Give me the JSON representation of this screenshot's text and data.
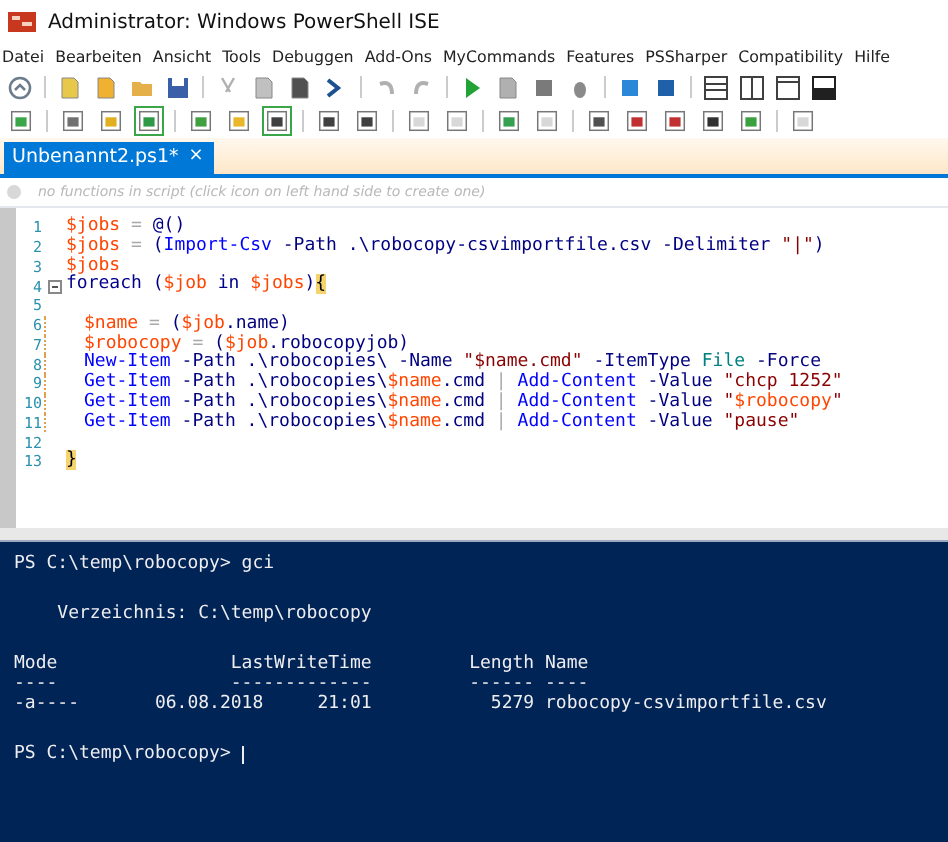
{
  "window": {
    "title": "Administrator: Windows PowerShell ISE"
  },
  "menu": [
    "Datei",
    "Bearbeiten",
    "Ansicht",
    "Tools",
    "Debuggen",
    "Add-Ons",
    "MyCommands",
    "Features",
    "PSSharper",
    "Compatibility",
    "Hilfe"
  ],
  "toolbar_2": {
    "groups": [
      [
        {
          "pressed": false,
          "disabled": false
        }
      ],
      [
        {
          "pressed": false,
          "disabled": false
        },
        {
          "pressed": false,
          "disabled": false
        },
        {
          "pressed": true,
          "disabled": false
        }
      ],
      [
        {
          "pressed": false,
          "disabled": false
        },
        {
          "pressed": false,
          "disabled": false
        },
        {
          "pressed": true,
          "disabled": false
        }
      ],
      [
        {
          "pressed": false,
          "disabled": false
        },
        {
          "pressed": false,
          "disabled": false
        }
      ],
      [
        {
          "pressed": false,
          "disabled": true
        },
        {
          "pressed": false,
          "disabled": true
        }
      ],
      [
        {
          "pressed": false,
          "disabled": false
        },
        {
          "pressed": false,
          "disabled": true
        }
      ],
      [
        {
          "pressed": false,
          "disabled": false
        },
        {
          "pressed": false,
          "disabled": false
        },
        {
          "pressed": false,
          "disabled": false
        },
        {
          "pressed": false,
          "disabled": false
        },
        {
          "pressed": false,
          "disabled": false
        }
      ],
      [
        {
          "pressed": false,
          "disabled": true
        }
      ]
    ]
  },
  "tabs": [
    {
      "label": "Unbenannt2.ps1*",
      "close": "×",
      "selected": true
    }
  ],
  "hint": "no functions in script (click icon on left hand side to create one)",
  "editor": {
    "lines": [
      {
        "n": "1",
        "fold": false,
        "indent": false,
        "tokens": [
          {
            "kind": "var",
            "text": "$jobs"
          },
          {
            "kind": "op",
            "text": " = "
          },
          {
            "kind": "plain",
            "text": "@()"
          }
        ]
      },
      {
        "n": "2",
        "fold": false,
        "indent": false,
        "tokens": [
          {
            "kind": "var",
            "text": "$jobs"
          },
          {
            "kind": "op",
            "text": " = "
          },
          {
            "kind": "plain",
            "text": "("
          },
          {
            "kind": "cmd",
            "text": "Import-Csv"
          },
          {
            "kind": "param",
            "text": " -Path"
          },
          {
            "kind": "plain",
            "text": " .\\robocopy-csvimportfile.csv"
          },
          {
            "kind": "param",
            "text": " -Delimiter"
          },
          {
            "kind": "str",
            "text": " \"|\""
          },
          {
            "kind": "plain",
            "text": ")"
          }
        ]
      },
      {
        "n": "3",
        "fold": false,
        "indent": false,
        "tokens": [
          {
            "kind": "var",
            "text": "$jobs"
          }
        ]
      },
      {
        "n": "4",
        "fold": true,
        "indent": false,
        "tokens": [
          {
            "kind": "kw",
            "text": "foreach"
          },
          {
            "kind": "plain",
            "text": " ("
          },
          {
            "kind": "var",
            "text": "$job"
          },
          {
            "kind": "kw",
            "text": " in "
          },
          {
            "kind": "var",
            "text": "$jobs"
          },
          {
            "kind": "plain",
            "text": ")"
          },
          {
            "kind": "brace",
            "text": "{"
          }
        ]
      },
      {
        "n": "5",
        "fold": false,
        "indent": true
      },
      {
        "n": "6",
        "fold": false,
        "indent": true,
        "tokens": [
          {
            "kind": "var",
            "text": "$name"
          },
          {
            "kind": "op",
            "text": " = "
          },
          {
            "kind": "plain",
            "text": "("
          },
          {
            "kind": "var",
            "text": "$job"
          },
          {
            "kind": "plain",
            "text": ".name)"
          }
        ]
      },
      {
        "n": "7",
        "fold": false,
        "indent": true,
        "tokens": [
          {
            "kind": "var",
            "text": "$robocopy"
          },
          {
            "kind": "op",
            "text": " = "
          },
          {
            "kind": "plain",
            "text": "("
          },
          {
            "kind": "var",
            "text": "$job"
          },
          {
            "kind": "plain",
            "text": ".robocopyjob)"
          }
        ]
      },
      {
        "n": "8",
        "fold": false,
        "indent": true,
        "tokens": [
          {
            "kind": "cmd",
            "text": "New-Item"
          },
          {
            "kind": "param",
            "text": " -Path"
          },
          {
            "kind": "plain",
            "text": " .\\robocopies\\ "
          },
          {
            "kind": "param",
            "text": "-Name"
          },
          {
            "kind": "str",
            "text": " \"$name.cmd\""
          },
          {
            "kind": "param",
            "text": " -ItemType"
          },
          {
            "kind": "type",
            "text": " File"
          },
          {
            "kind": "param",
            "text": " -Force"
          }
        ]
      },
      {
        "n": "9",
        "fold": false,
        "indent": true,
        "tokens": [
          {
            "kind": "cmd",
            "text": "Get-Item"
          },
          {
            "kind": "param",
            "text": " -Path"
          },
          {
            "kind": "plain",
            "text": " .\\robocopies\\"
          },
          {
            "kind": "var",
            "text": "$name"
          },
          {
            "kind": "plain",
            "text": ".cmd"
          },
          {
            "kind": "op",
            "text": " | "
          },
          {
            "kind": "cmd",
            "text": "Add-Content"
          },
          {
            "kind": "param",
            "text": " -Value"
          },
          {
            "kind": "str",
            "text": " \"chcp 1252\""
          }
        ]
      },
      {
        "n": "10",
        "fold": false,
        "indent": true,
        "tokens": [
          {
            "kind": "cmd",
            "text": "Get-Item"
          },
          {
            "kind": "param",
            "text": " -Path"
          },
          {
            "kind": "plain",
            "text": " .\\robocopies\\"
          },
          {
            "kind": "var",
            "text": "$name"
          },
          {
            "kind": "plain",
            "text": ".cmd"
          },
          {
            "kind": "op",
            "text": " | "
          },
          {
            "kind": "cmd",
            "text": "Add-Content"
          },
          {
            "kind": "param",
            "text": " -Value"
          },
          {
            "kind": "str",
            "text": " \""
          },
          {
            "kind": "var",
            "text": "$robocopy"
          },
          {
            "kind": "str",
            "text": "\""
          }
        ]
      },
      {
        "n": "11",
        "fold": false,
        "indent": true,
        "tokens": [
          {
            "kind": "cmd",
            "text": "Get-Item"
          },
          {
            "kind": "param",
            "text": " -Path"
          },
          {
            "kind": "plain",
            "text": " .\\robocopies\\"
          },
          {
            "kind": "var",
            "text": "$name"
          },
          {
            "kind": "plain",
            "text": ".cmd"
          },
          {
            "kind": "op",
            "text": " | "
          },
          {
            "kind": "cmd",
            "text": "Add-Content"
          },
          {
            "kind": "param",
            "text": " -Value"
          },
          {
            "kind": "str",
            "text": " \"pause\""
          }
        ]
      },
      {
        "n": "12",
        "fold": false,
        "indent": true
      },
      {
        "n": "13",
        "fold": false,
        "indent": false,
        "tokens": [
          {
            "kind": "brace",
            "text": "}"
          }
        ]
      }
    ]
  },
  "console": {
    "blocks": [
      [
        "PS C:\\temp\\robocopy> gci"
      ],
      [
        "    Verzeichnis: C:\\temp\\robocopy"
      ],
      [
        "Mode                LastWriteTime         Length Name",
        "----                -------------         ------ ----",
        "-a----       06.08.2018     21:01           5279 robocopy-csvimportfile.csv"
      ],
      [
        "PS C:\\temp\\robocopy> "
      ]
    ],
    "cursor": true
  }
}
